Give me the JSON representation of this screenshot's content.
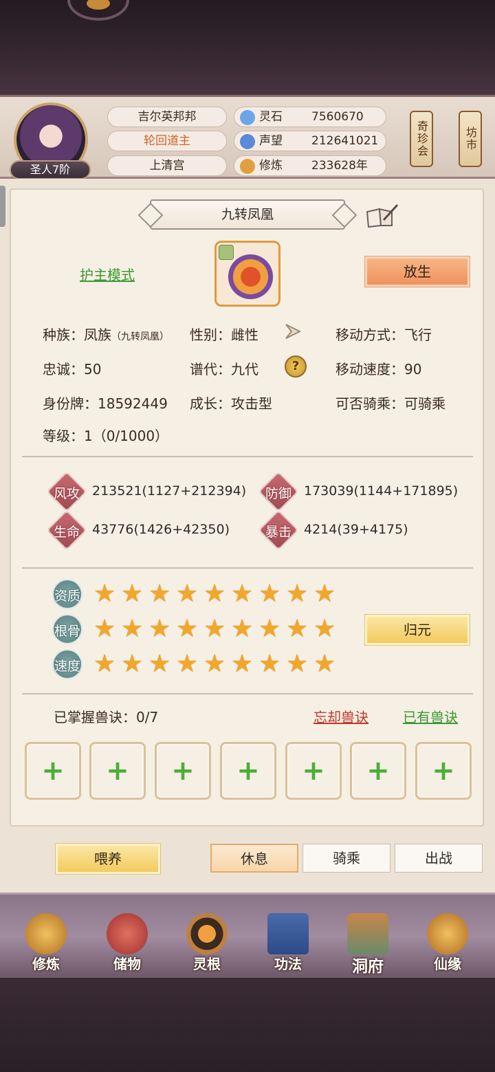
{
  "player": {
    "rank": "圣人7阶",
    "name": "吉尔英邦邦",
    "title": "轮回道主",
    "sect": "上清宫"
  },
  "resources": [
    {
      "label": "灵石",
      "value": "7560670",
      "icon": "spirit-stone-icon",
      "color": "#6aa6e8"
    },
    {
      "label": "声望",
      "value": "212641021",
      "icon": "reputation-flame-icon",
      "color": "#5a8ad8"
    },
    {
      "label": "修炼",
      "value": "233628年",
      "icon": "meditation-icon",
      "color": "#e0a040"
    }
  ],
  "shops": {
    "treasure": "奇珍会",
    "market": "坊市"
  },
  "pet": {
    "name": "九转凤凰",
    "guard_mode": "护主模式",
    "release": "放生",
    "race_label": "种族：",
    "race": "凤族",
    "race_sub": "（九转凤凰）",
    "gender_label": "性别：",
    "gender": "雌性",
    "move_type_label": "移动方式：",
    "move_type": "飞行",
    "loyalty_label": "忠诚：",
    "loyalty": "50",
    "generation_label": "谱代：",
    "generation": "九代",
    "move_speed_label": "移动速度：",
    "move_speed": "90",
    "id_label": "身份牌：",
    "id": "18592449",
    "growth_label": "成长：",
    "growth": "攻击型",
    "rideable_label": "可否骑乘：",
    "rideable": "可骑乘",
    "level_label": "等级：",
    "level": "1（0/1000）"
  },
  "stats": [
    {
      "label": "风攻",
      "value": "213521(1127+212394)"
    },
    {
      "label": "防御",
      "value": "173039(1144+171895)"
    },
    {
      "label": "生命",
      "value": "43776(1426+42350)"
    },
    {
      "label": "暴击",
      "value": "4214(39+4175)"
    }
  ],
  "qualities": [
    {
      "label": "资质",
      "stars": 9
    },
    {
      "label": "根骨",
      "stars": 9
    },
    {
      "label": "速度",
      "stars": 9
    }
  ],
  "return_button": "归元",
  "skills": {
    "mastered_label": "已掌握兽诀：",
    "mastered": "0/7",
    "forget": "忘却兽诀",
    "owned": "已有兽诀",
    "slot_plus": "+"
  },
  "actions": {
    "feed": "喂养",
    "rest": "休息",
    "ride": "骑乘",
    "battle": "出战"
  },
  "nav": [
    {
      "label": "修炼",
      "icon": "cultivation-monk-icon"
    },
    {
      "label": "储物",
      "icon": "storage-bag-icon"
    },
    {
      "label": "灵根",
      "icon": "spirit-root-icon"
    },
    {
      "label": "功法",
      "icon": "technique-book-icon"
    },
    {
      "label": "洞府",
      "icon": "cave-abode-icon"
    },
    {
      "label": "仙缘",
      "icon": "fate-gourd-icon"
    }
  ]
}
